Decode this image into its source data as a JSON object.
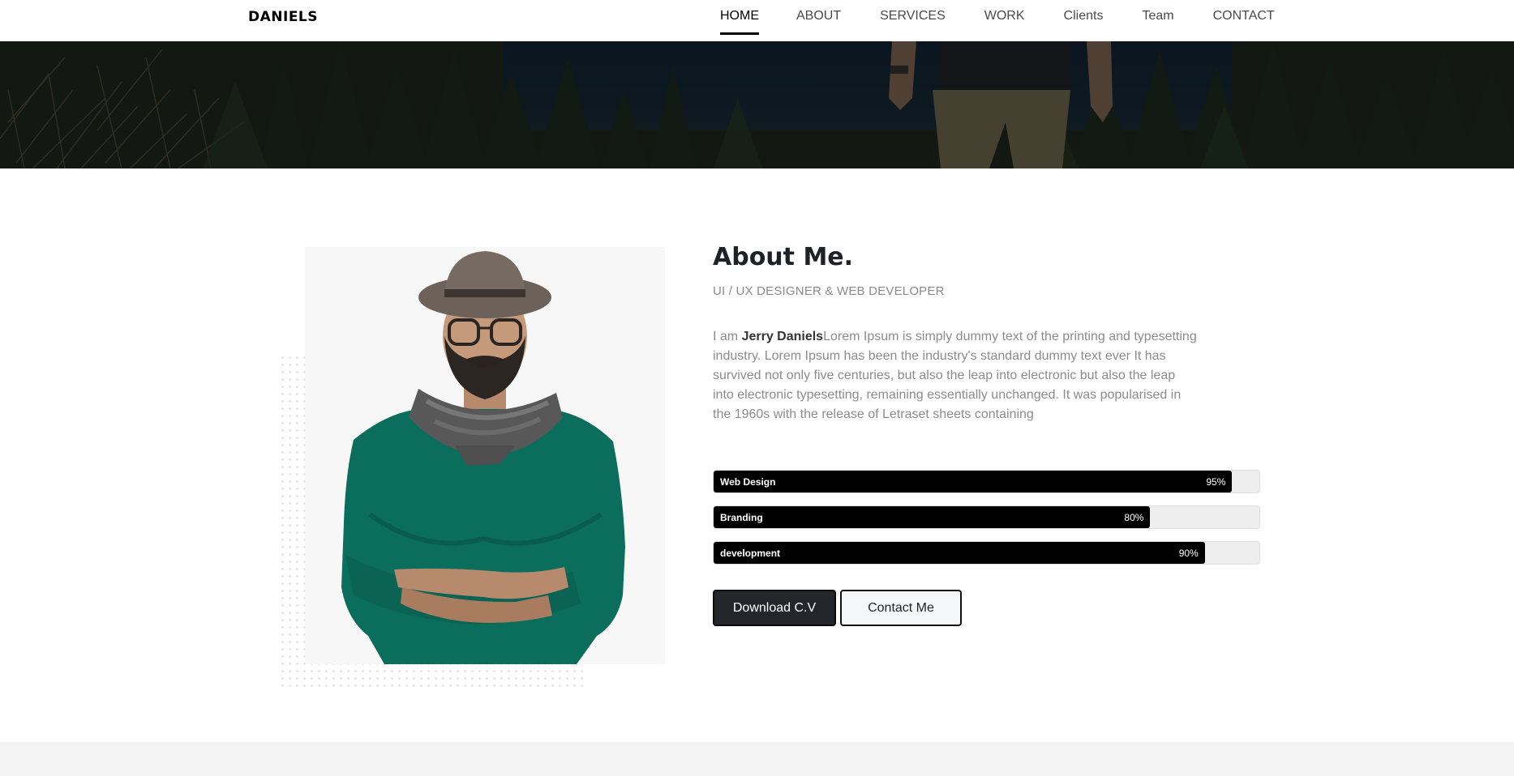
{
  "brand": "DANIELS",
  "nav": {
    "items": [
      {
        "label": "HOME",
        "active": true
      },
      {
        "label": "ABOUT",
        "active": false
      },
      {
        "label": "SERVICES",
        "active": false
      },
      {
        "label": "WORK",
        "active": false
      },
      {
        "label": "Clients",
        "active": false
      },
      {
        "label": "Team",
        "active": false
      },
      {
        "label": "CONTACT",
        "active": false
      }
    ]
  },
  "about": {
    "title": "About Me.",
    "subtitle": "UI / UX DESIGNER & WEB DEVELOPER",
    "intro": "I am ",
    "name": "Jerry Daniels",
    "text": "Lorem Ipsum is simply dummy text of the printing and typesetting industry. Lorem Ipsum has been the industry's standard dummy text ever It has survived not only five centuries, but also the leap into electronic but also the leap into electronic typesetting, remaining essentially unchanged. It was popularised in the 1960s with the release of Letraset sheets containing"
  },
  "skills": [
    {
      "name": "Web Design",
      "percent": "95%",
      "value": 95
    },
    {
      "name": "Branding",
      "percent": "80%",
      "value": 80
    },
    {
      "name": "development",
      "percent": "90%",
      "value": 90
    }
  ],
  "buttons": {
    "download": "Download C.V",
    "contact": "Contact Me"
  },
  "colors": {
    "accent": "#000000",
    "button_dark": "#23272b",
    "text_muted": "#8c8c8c"
  }
}
